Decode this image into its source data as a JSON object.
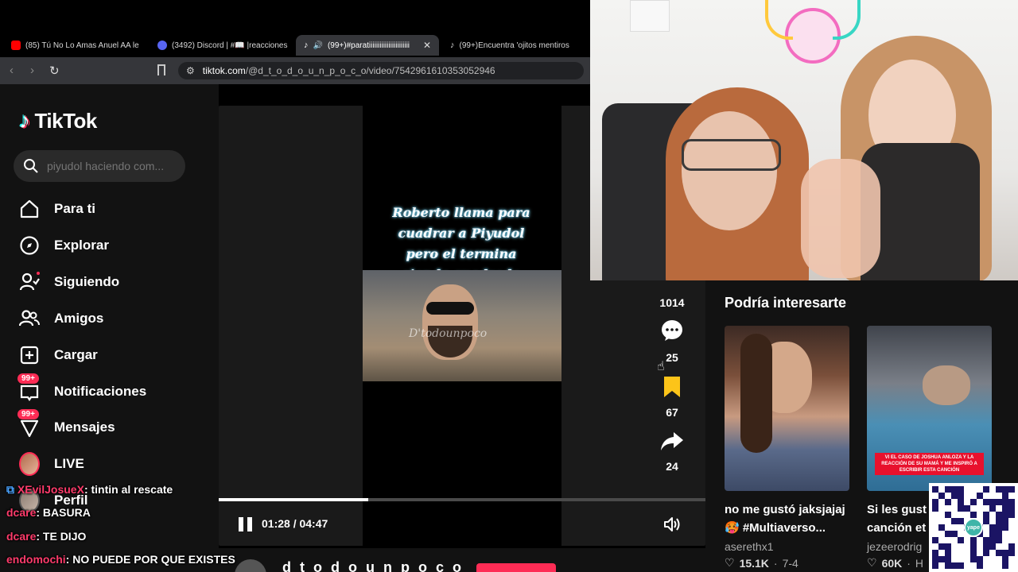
{
  "browser": {
    "tabs": [
      {
        "title": "(85) Tú No Lo Amas Anuel AA le",
        "favicon_color": "#ff0000"
      },
      {
        "title": "(3492) Discord | #📖 |reacciones",
        "favicon_color": "#5865f2"
      },
      {
        "title": "(99+)#paratiiiiiiiiiiiiiiiiiiiiiii",
        "favicon_color": "#ffffff",
        "active": true
      },
      {
        "title": "(99+)Encuentra 'ojitos mentiros",
        "favicon_color": "#ffffff"
      }
    ],
    "close_glyph": "✕",
    "url_host": "tiktok.com",
    "url_path": "/@d_t_o_d_o_u_n_p_o_c_o/video/7542961610353052946"
  },
  "sidebar": {
    "logo_text": "TikTok",
    "search_placeholder": "piyudol haciendo com...",
    "items": [
      {
        "label": "Para ti",
        "icon": "home-icon"
      },
      {
        "label": "Explorar",
        "icon": "compass-icon"
      },
      {
        "label": "Siguiendo",
        "icon": "following-icon"
      },
      {
        "label": "Amigos",
        "icon": "friends-icon"
      },
      {
        "label": "Cargar",
        "icon": "upload-icon"
      },
      {
        "label": "Notificaciones",
        "icon": "inbox-icon",
        "badge": "99+"
      },
      {
        "label": "Mensajes",
        "icon": "messages-icon",
        "badge": "99+"
      },
      {
        "label": "LIVE",
        "icon": "live-avatar"
      },
      {
        "label": "Perfil",
        "icon": "profile-avatar"
      }
    ]
  },
  "player": {
    "caption_lines": [
      "Roberto llama para",
      "cuadrar a Piyudol",
      "pero el termina",
      "siendo cuadrado"
    ],
    "watermark": "D'todounpoco",
    "current_time": "01:28",
    "separator": " / ",
    "duration": "04:47",
    "progress": 0.307
  },
  "actions": {
    "likes": "1014",
    "comments": "25",
    "saves": "67",
    "shares": "24"
  },
  "recommendations": {
    "title": "Podría interesarte",
    "cards": [
      {
        "caption": "no me gustó jaksjajaj",
        "caption2": "🥵 #Multiaverso...",
        "author": "aserethx1",
        "likes": "15.1K",
        "date": "7-4"
      },
      {
        "caption": "Si les gust",
        "caption2": "canción et",
        "author": "jezeerodrig",
        "likes": "60K",
        "date": "H"
      }
    ],
    "overlay_text": "VI EL CASO DE JOSHUA ANLOZA Y LA REACCIÓN DE SU MAMÁ Y ME INSPIRÓ A ESCRIBIR ESTA CANCIÓN"
  },
  "bottom": {
    "author_name": "d t o d o u n p o c o"
  },
  "chat": [
    {
      "user": "XEvilJosueX",
      "message": ": tintin al rescate"
    },
    {
      "user": "dcare",
      "message": ": BASURA"
    },
    {
      "user": "dcare",
      "message": ": TE DIJO"
    },
    {
      "user": "endomochi",
      "message": ": NO PUEDE POR QUE EXISTES"
    }
  ],
  "qr": {
    "brand": "yape"
  },
  "colors": {
    "accent": "#fe2c55",
    "sidebar_bg": "#121212",
    "chrome_bg": "#35363a"
  }
}
